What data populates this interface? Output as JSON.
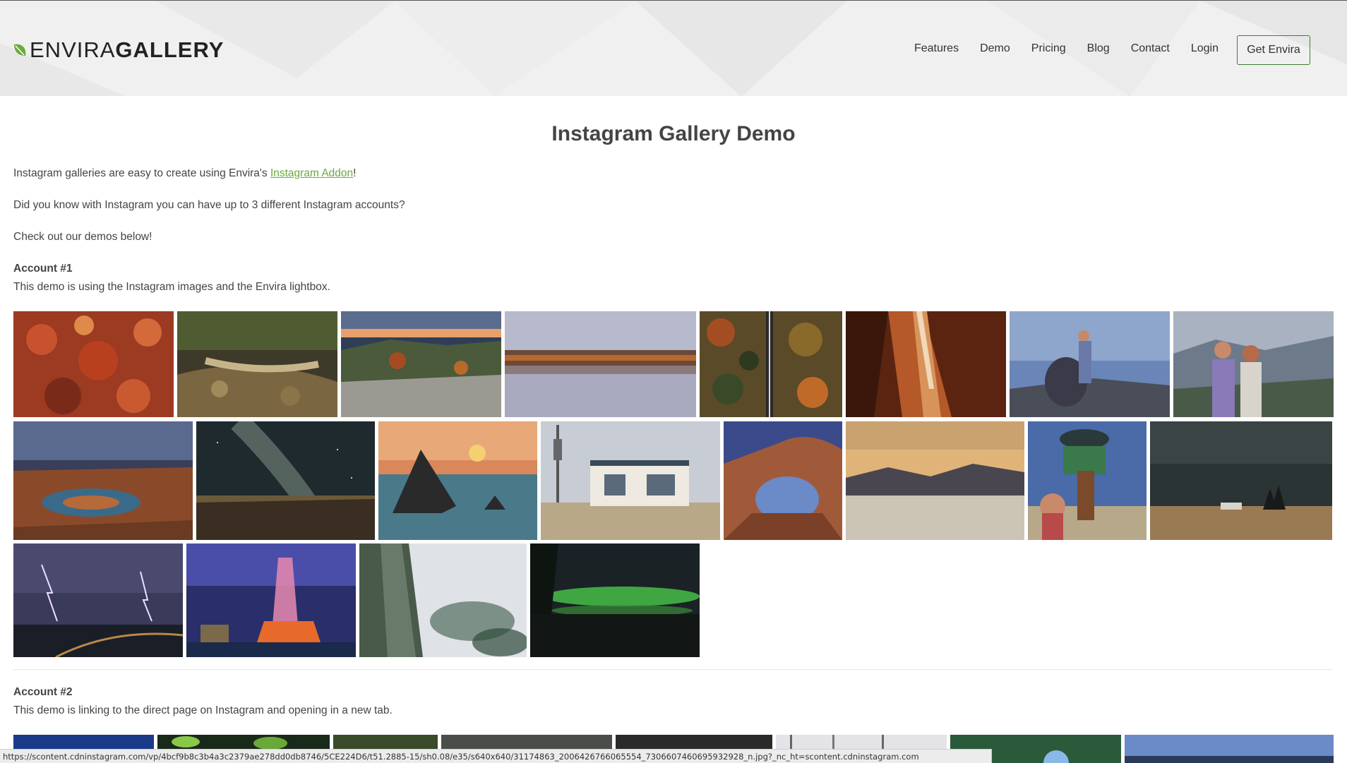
{
  "brand": {
    "logo_light": "ENVIRA",
    "logo_bold": "GALLERY",
    "leaf_color": "#6aab3b"
  },
  "nav": {
    "items": [
      "Features",
      "Demo",
      "Pricing",
      "Blog",
      "Contact",
      "Login"
    ],
    "cta_label": "Get Envira",
    "cta_border_color": "#3f7d2f"
  },
  "page": {
    "title": "Instagram Gallery Demo",
    "intro_text": "Instagram galleries are easy to create using Envira's ",
    "intro_link": "Instagram Addon",
    "intro_end": "!",
    "line2": "Did you know with Instagram you can have up to 3 different Instagram accounts?",
    "line3": "Check out our demos below!",
    "link_color": "#6aab3b"
  },
  "accounts": [
    {
      "heading": "Account #1",
      "description": "This demo is using the Instagram images and the Envira lightbox."
    },
    {
      "heading": "Account #2",
      "description": "This demo is linking to the direct page on Instagram and opening in a new tab."
    }
  ],
  "gallery_images": [
    "autumn-leaves-photo",
    "forest-stream-photo",
    "mountain-sunset-photo",
    "misty-lake-photo",
    "aerial-forest-road-photo",
    "slot-canyon-photo",
    "couple-cliff-photo",
    "couple-mountains-photo",
    "canyon-river-bend-photo",
    "milky-way-photo",
    "sea-stack-sunset-photo",
    "old-gas-station-photo",
    "rock-arch-photo",
    "desert-dunes-photo",
    "roadside-sign-photo",
    "storm-field-photo",
    "lightning-city-photo",
    "fountain-night-photo",
    "foggy-cliff-photo",
    "aurora-lake-photo"
  ],
  "statusbar": {
    "url": "https://scontent.cdninstagram.com/vp/4bcf9b8c3b4a3c2379ae278dd0db8746/5CE224D6/t51.2885-15/sh0.08/e35/s640x640/31174863_2006426766065554_7306607460695932928_n.jpg?_nc_ht=scontent.cdninstagram.com"
  }
}
